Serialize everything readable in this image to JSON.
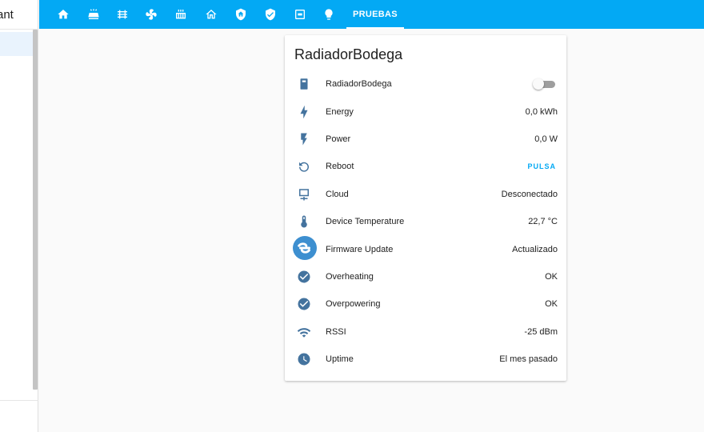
{
  "app": {
    "title_fragment": "ant"
  },
  "topbar": {
    "tabs": [
      {
        "icon": "home-icon"
      },
      {
        "icon": "solar-panel-icon"
      },
      {
        "icon": "radiator-icon"
      },
      {
        "icon": "fan-auto-icon"
      },
      {
        "icon": "heater-icon"
      },
      {
        "icon": "home-outline-icon"
      },
      {
        "icon": "shield-home-icon"
      },
      {
        "icon": "shield-check-icon"
      },
      {
        "icon": "switch-icon"
      },
      {
        "icon": "lightbulb-icon"
      }
    ],
    "active_tab_label": "PRUEBAS"
  },
  "card": {
    "title": "RadiadorBodega",
    "rows": [
      {
        "icon": "socket-icon",
        "name": "RadiadorBodega",
        "type": "toggle",
        "state": "off"
      },
      {
        "icon": "lightning-bolt-icon",
        "name": "Energy",
        "value": "0,0 kWh"
      },
      {
        "icon": "flash-icon",
        "name": "Power",
        "value": "0,0 W"
      },
      {
        "icon": "restart-icon",
        "name": "Reboot",
        "action": "PULSA"
      },
      {
        "icon": "cloud-lan-icon",
        "name": "Cloud",
        "value": "Desconectado"
      },
      {
        "icon": "thermometer-icon",
        "name": "Device Temperature",
        "value": "22,7 °C"
      },
      {
        "icon": "shelly-logo",
        "name": "Firmware Update",
        "value": "Actualizado"
      },
      {
        "icon": "check-circle-icon",
        "name": "Overheating",
        "value": "OK"
      },
      {
        "icon": "check-circle-icon",
        "name": "Overpowering",
        "value": "OK"
      },
      {
        "icon": "wifi-icon",
        "name": "RSSI",
        "value": "-25 dBm"
      },
      {
        "icon": "clock-icon",
        "name": "Uptime",
        "value": "El mes pasado"
      }
    ]
  },
  "colors": {
    "header": "#03a9f4",
    "icon": "#44739e",
    "action": "#03a9f4"
  }
}
